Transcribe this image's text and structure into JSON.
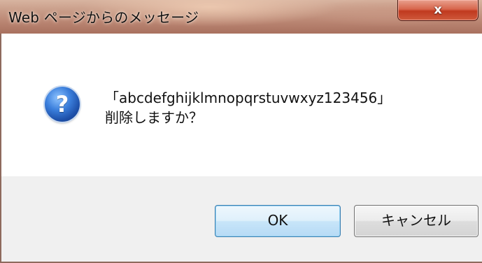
{
  "window": {
    "title": "Web ページからのメッセージ",
    "close_glyph": "x"
  },
  "dialog": {
    "icon": "question-icon",
    "icon_glyph": "?",
    "message_line1": "「abcdefghijklmnopqrstuvwxyz123456」",
    "message_line2": "削除しますか？"
  },
  "buttons": {
    "ok_label": "OK",
    "cancel_label": "キャンセル"
  },
  "colors": {
    "title_bar": "#c79a86",
    "close_button": "#c0391f",
    "button_area": "#f0f0f0",
    "default_button_border": "#3c7fb1"
  }
}
